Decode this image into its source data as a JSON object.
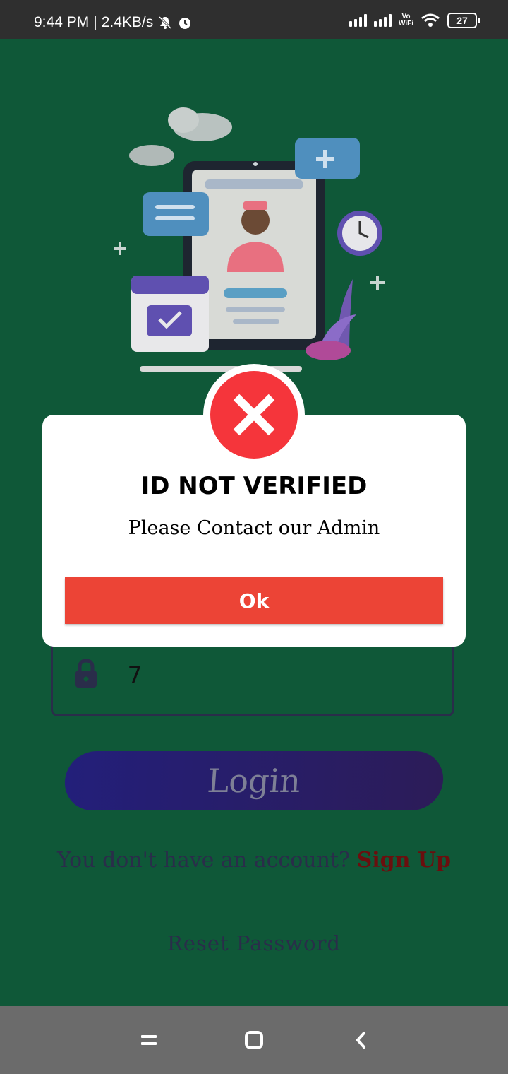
{
  "status_bar": {
    "time": "9:44 PM",
    "speed": "2.4KB/s",
    "battery": "27",
    "vowifi_top": "Vo",
    "vowifi_bottom": "WiFi",
    "icons": [
      "mute-icon",
      "alarm-icon",
      "signal-icon",
      "signal-icon",
      "wifi-icon",
      "battery-icon"
    ]
  },
  "login": {
    "password_value": "7",
    "login_label": "Login",
    "no_account_text": "You don't have an account?",
    "signup_label": "Sign Up",
    "reset_label": "Reset Password"
  },
  "dialog": {
    "icon": "error-x-icon",
    "title": "ID NOT VERIFIED",
    "message": "Please Contact our Admin",
    "ok_label": "Ok"
  },
  "colors": {
    "background": "#0f5838",
    "error_red": "#f5353b",
    "ok_button": "#ec4436",
    "login_button": "#231f7a",
    "signup_link": "#6b0e0e"
  },
  "nav_bar": {
    "icons": [
      "menu-icon",
      "home-icon",
      "back-icon"
    ]
  }
}
